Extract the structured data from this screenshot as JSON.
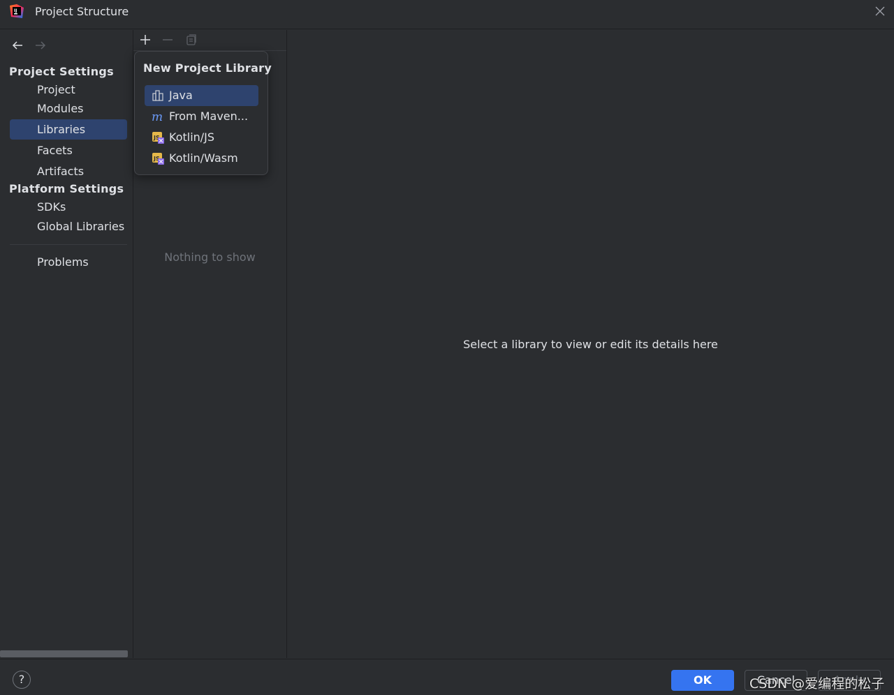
{
  "window": {
    "title": "Project Structure",
    "logo_icon": "intellij-idea-icon"
  },
  "sidebar": {
    "nav_back_icon": "arrow-left-icon",
    "nav_forward_icon": "arrow-right-icon",
    "project_settings_header": "Project Settings",
    "project_settings_items": [
      {
        "label": "Project"
      },
      {
        "label": "Modules"
      },
      {
        "label": "Libraries",
        "selected": true
      },
      {
        "label": "Facets"
      },
      {
        "label": "Artifacts"
      }
    ],
    "platform_settings_header": "Platform Settings",
    "platform_settings_items": [
      {
        "label": "SDKs"
      },
      {
        "label": "Global Libraries"
      }
    ],
    "problems_label": "Problems"
  },
  "list_panel": {
    "toolbar": {
      "add_icon": "plus-icon",
      "remove_icon": "minus-icon",
      "copy_icon": "copy-icon"
    },
    "empty_text": "Nothing to show"
  },
  "popup": {
    "title": "New Project Library",
    "items": [
      {
        "label": "Java",
        "icon": "library-icon",
        "selected": true
      },
      {
        "label": "From Maven...",
        "icon": "maven-icon"
      },
      {
        "label": "Kotlin/JS",
        "icon": "kotlin-js-icon"
      },
      {
        "label": "Kotlin/Wasm",
        "icon": "kotlin-wasm-icon"
      }
    ]
  },
  "detail_panel": {
    "hint": "Select a library to view or edit its details here"
  },
  "footer": {
    "help_label": "?",
    "ok_label": "OK",
    "cancel_label": "Cancel",
    "apply_label": "Apply",
    "watermark": "CSDN @爱编程的松子"
  },
  "colors": {
    "background": "#2b2d30",
    "selection": "#2e436e",
    "primary_button": "#3574f0",
    "text": "#dfe1e5",
    "muted_text": "#6f737a"
  }
}
